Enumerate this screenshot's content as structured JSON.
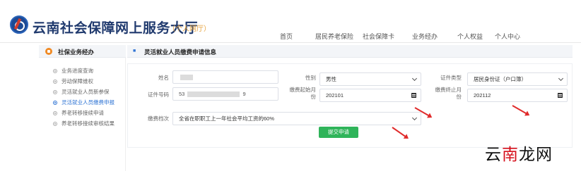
{
  "header": {
    "title": "云南社会保障网上服务大厅",
    "subtitle": "（个人网厅）",
    "nav": [
      "首页",
      "居民养老保险",
      "社会保障卡",
      "业务经办",
      "个人权益",
      "个人中心"
    ]
  },
  "sidebar": {
    "heading": "社保业务经办",
    "items": [
      {
        "label": "业务进度查询",
        "active": false
      },
      {
        "label": "劳动保障维权",
        "active": false
      },
      {
        "label": "灵活就业人员新参保",
        "active": false
      },
      {
        "label": "灵活就业人员缴费申报",
        "active": true
      },
      {
        "label": "养老转移接续申请",
        "active": false
      },
      {
        "label": "养老转移接续审核结果",
        "active": false
      }
    ]
  },
  "main": {
    "heading": "灵活就业人员缴费申请信息",
    "form": {
      "name_label": "姓名",
      "gender_label": "性别",
      "gender_value": "男性",
      "id_type_label": "证件类型",
      "id_type_value": "居民身份证（户口簿）",
      "id_no_label": "证件号码",
      "id_no_prefix": "53",
      "id_no_suffix": "9",
      "start_label": "缴费起始月份",
      "start_value": "202101",
      "end_label": "缴费终止月份",
      "end_value": "202112",
      "grade_label": "缴费档次",
      "grade_value": "全省在职职工上一年社会平均工资的60%"
    },
    "submit_label": "提交申请"
  },
  "watermark": {
    "a": "云",
    "b": "南",
    "c": "龙网"
  },
  "colors": {
    "accent_blue": "#2f74d4",
    "submit_green": "#2fb45a",
    "annotation_red": "#e02b2b",
    "subtitle_orange": "#e6a23c"
  }
}
